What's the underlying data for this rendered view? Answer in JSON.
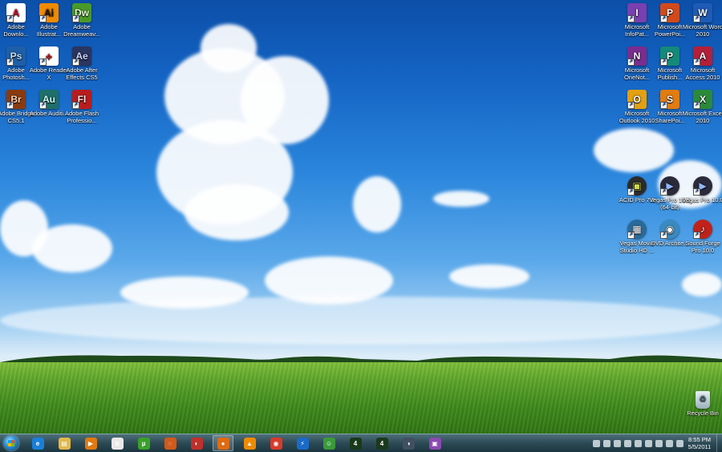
{
  "desktop": {
    "icons_left": [
      {
        "label": "Adobe Downlo...",
        "glyph": "A",
        "color": "#ffffff",
        "fg": "#c8102e",
        "icon": "adobe-download-icon"
      },
      {
        "label": "Adobe Illustrat...",
        "glyph": "Ai",
        "color": "#f08a00",
        "fg": "#2b1a00",
        "icon": "illustrator-icon"
      },
      {
        "label": "Adobe Dreamweav...",
        "glyph": "Dw",
        "color": "#4a9a2a",
        "fg": "#e8ffd8",
        "icon": "dreamweaver-icon"
      },
      {
        "label": "Adobe Photosh...",
        "glyph": "Ps",
        "color": "#1f5fa8",
        "fg": "#bfe3ff",
        "icon": "photoshop-icon"
      },
      {
        "label": "Adobe Reader X",
        "glyph": "⟡",
        "color": "#ffffff",
        "fg": "#d01616",
        "icon": "adobe-reader-icon"
      },
      {
        "label": "Adobe After Effects CS5",
        "glyph": "Ae",
        "color": "#2a3560",
        "fg": "#cdd7ff",
        "icon": "after-effects-icon"
      },
      {
        "label": "Adobe Bridge CS5.1",
        "glyph": "Br",
        "color": "#8a3a10",
        "fg": "#ffd4b0",
        "icon": "bridge-icon"
      },
      {
        "label": "Adobe Auditi...",
        "glyph": "Au",
        "color": "#1f6f6a",
        "fg": "#c8fff6",
        "icon": "audition-icon"
      },
      {
        "label": "Adobe Flash Professio...",
        "glyph": "Fl",
        "color": "#b81d1d",
        "fg": "#ffe0e0",
        "icon": "flash-icon"
      }
    ],
    "icons_right": [
      {
        "label": "Microsoft InfoPat...",
        "glyph": "I",
        "color": "#7a3fb0",
        "fg": "#ffffff",
        "icon": "infopath-icon"
      },
      {
        "label": "Microsoft PowerPoi...",
        "glyph": "P",
        "color": "#d24a1c",
        "fg": "#ffffff",
        "icon": "powerpoint-icon"
      },
      {
        "label": "Microsoft Word 2010",
        "glyph": "W",
        "color": "#1e5bb8",
        "fg": "#ffffff",
        "icon": "word-icon"
      },
      {
        "label": "Microsoft OneNot...",
        "glyph": "N",
        "color": "#7b2c8f",
        "fg": "#ffffff",
        "icon": "onenote-icon"
      },
      {
        "label": "Microsoft Publish...",
        "glyph": "P",
        "color": "#138a7a",
        "fg": "#ffffff",
        "icon": "publisher-icon"
      },
      {
        "label": "Microsoft Access 2010",
        "glyph": "A",
        "color": "#b41f3a",
        "fg": "#ffffff",
        "icon": "access-icon"
      },
      {
        "label": "Microsoft Outlook 2010",
        "glyph": "O",
        "color": "#e2a012",
        "fg": "#ffffff",
        "icon": "outlook-icon"
      },
      {
        "label": "Microsoft SharePoi...",
        "glyph": "S",
        "color": "#e07c10",
        "fg": "#ffffff",
        "icon": "sharepoint-icon"
      },
      {
        "label": "Microsoft Excel 2010",
        "glyph": "X",
        "color": "#2a8a3a",
        "fg": "#ffffff",
        "icon": "excel-icon"
      },
      {
        "label": "ACID Pro 7.0",
        "glyph": "▣",
        "color": "#2b2b2b",
        "fg": "#cfd84a",
        "icon": "acid-pro-icon"
      },
      {
        "label": "Vegas Pro 10.0 (64-bit)",
        "glyph": "▶",
        "color": "#2a2a3a",
        "fg": "#8fb8ff",
        "icon": "vegas-pro-64-icon"
      },
      {
        "label": "Vegas Pro 10.0",
        "glyph": "▶",
        "color": "#2a2a3a",
        "fg": "#8fb8ff",
        "icon": "vegas-pro-icon"
      },
      {
        "label": "Vegas Movie Studio HD ...",
        "glyph": "▦",
        "color": "#2a6a9a",
        "fg": "#ffffff",
        "icon": "vegas-movie-studio-icon"
      },
      {
        "label": "DVD Archite...",
        "glyph": "◉",
        "color": "#3a8ac0",
        "fg": "#ffffff",
        "icon": "dvd-architect-icon"
      },
      {
        "label": "Sound Forge Pro 10.0",
        "glyph": "♪",
        "color": "#c0221a",
        "fg": "#ffffff",
        "icon": "sound-forge-icon"
      }
    ],
    "recycle_bin": {
      "label": "Recycle Bin",
      "icon": "recycle-bin-icon"
    }
  },
  "taskbar": {
    "start_icon": "windows-start-orb-icon",
    "items": [
      {
        "name": "internet-explorer",
        "glyph": "e",
        "color": "#1a7fd8",
        "icon": "internet-explorer-icon"
      },
      {
        "name": "windows-explorer",
        "glyph": "▤",
        "color": "#e2b84a",
        "icon": "folder-icon"
      },
      {
        "name": "media-player",
        "glyph": "▶",
        "color": "#e07a10",
        "icon": "media-player-icon"
      },
      {
        "name": "app-4",
        "glyph": "≋",
        "color": "#e8e8e8",
        "icon": "app-icon"
      },
      {
        "name": "utorrent",
        "glyph": "µ",
        "color": "#3aa02a",
        "icon": "utorrent-icon"
      },
      {
        "name": "app-6",
        "glyph": "◌",
        "color": "#d05a1a",
        "icon": "app-icon"
      },
      {
        "name": "app-7",
        "glyph": "◐",
        "color": "#c0302a",
        "icon": "app-icon"
      },
      {
        "name": "firefox",
        "glyph": "●",
        "color": "#e06a12",
        "icon": "firefox-icon",
        "active": true
      },
      {
        "name": "vlc",
        "glyph": "▲",
        "color": "#f08a00",
        "icon": "vlc-icon"
      },
      {
        "name": "chrome",
        "glyph": "◉",
        "color": "#d93a2a",
        "icon": "chrome-icon"
      },
      {
        "name": "app-11",
        "glyph": "⚡",
        "color": "#1a6ac8",
        "icon": "app-icon"
      },
      {
        "name": "messenger",
        "glyph": "☺",
        "color": "#3a9a3a",
        "icon": "messenger-icon"
      },
      {
        "name": "app-13",
        "glyph": "4",
        "color": "#1a3a1a",
        "icon": "app-icon"
      },
      {
        "name": "app-14",
        "glyph": "4",
        "color": "#1a3a1a",
        "icon": "app-icon"
      },
      {
        "name": "app-15",
        "glyph": "◑",
        "color": "#405060",
        "icon": "app-icon"
      },
      {
        "name": "app-16",
        "glyph": "▣",
        "color": "#8a4ab0",
        "icon": "app-icon"
      }
    ],
    "clock": {
      "time": "8:55 PM",
      "date": "5/5/2011"
    }
  }
}
